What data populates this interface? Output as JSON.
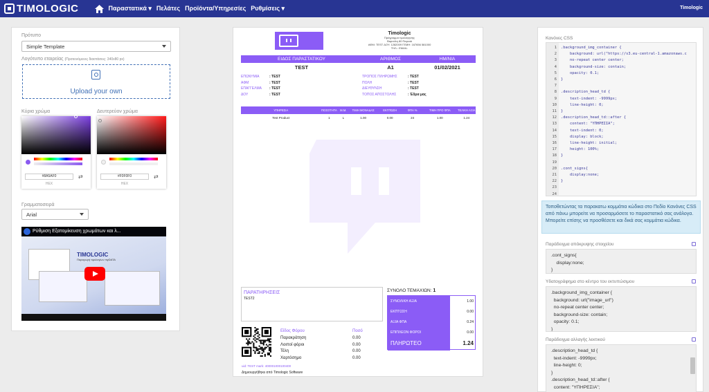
{
  "nav": {
    "brand": "TIMOLOGIC",
    "items": [
      "Παραστατικά ▾",
      "Πελάτες",
      "Προϊόντα/Υπηρεσίες",
      "Ρυθμίσεις ▾"
    ],
    "user": "Timologic"
  },
  "left": {
    "template_label": "Πρότυπο",
    "template_value": "Simple Template",
    "logo_label": "Λογότυπο εταιρείας",
    "logo_hint": "(Προτεινόμενες διαστάσεις: 340x80 px)",
    "upload_text": "Upload your own",
    "primary_color_label": "Κύρια χρώμα",
    "secondary_color_label": "Δευτερεύον χρώμα",
    "primary_hex": "#8A5AF0",
    "secondary_hex": "#F0F0F0",
    "hex_label": "HEX",
    "font_label": "Γραμματοσειρά",
    "font_value": "Arial",
    "video_title": "Ρύθμιση Εξατομίκευση χρωμάτων και λ...",
    "video_brand": "TIMOLOGIC",
    "video_sub": "Παραγωγή τιμολογίων myDATA"
  },
  "colors": {
    "accent": "#8b5cf6",
    "navbar": "#283593",
    "picker_primary_hue": "#7b3fe0",
    "picker_secondary_hue": "#ff1a1a"
  },
  "doc": {
    "company": {
      "name": "Timologic",
      "lines": [
        "Πρόγραμμα τιμολόγησης",
        "Βαρνάλη 80 Πειραιά",
        "ΑΦΜ: TEST ΔΟΥ: 1282009 ΓΕΜΗ: 167656 581000",
        "ΤΗΛ.: EMAIL:"
      ]
    },
    "header_cols": [
      "ΕΙΔΟΣ ΠΑΡΑΣΤΑΤΙΚΟΥ",
      "ΑΡΙΘΜΟΣ",
      "ΗΜ/ΝΙΑ"
    ],
    "header_vals": [
      "TEST",
      "A1",
      "01/02/2021"
    ],
    "info_left": [
      {
        "k": "ΕΠΩΝΥΜΙΑ",
        "v": ": TEST"
      },
      {
        "k": "ΑΦΜ",
        "v": ": TEST"
      },
      {
        "k": "ΕΠΑΓΓΕΛΜΑ",
        "v": ": TEST"
      },
      {
        "k": "ΔΟΥ",
        "v": ": TEST"
      }
    ],
    "info_right": [
      {
        "k": "ΤΡΟΠΟΣ ΠΛΗΡΩΜΗΣ",
        "v": ": TEST"
      },
      {
        "k": "ΠΟΛΗ",
        "v": ": TEST"
      },
      {
        "k": "ΔΙΕΥΘΥΝΣΗ",
        "v": ": TEST"
      },
      {
        "k": "ΤΟΠΟΣ ΑΠΟΣΤΟΛΗΣ",
        "v": ": Έδρα μας"
      }
    ],
    "items_cols": [
      "ΥΠΗΡΕΣΙΑ",
      "ΠΟΣΟΤΗΤΑ",
      "Μ.Μ.",
      "ΤΙΜΗ ΜΟΝΑΔΑΣ",
      "ΕΚΠΤΩΣΗ",
      "ΦΠΑ %",
      "ΤΙΜΗ ΠΡΟ ΦΠΑ",
      "ΤΕΛΙΚΗ ΑΞΙΑ"
    ],
    "items_row": [
      "Test Product",
      "1",
      "L",
      "1.00",
      "0.00",
      "24",
      "1.00",
      "1.24"
    ],
    "notes_title": "ΠΑΡΑΤΗΡΗΣΕΙΣ",
    "notes_text": "TEST2",
    "tax_head": [
      "Είδος Φόρου",
      "Ποσό"
    ],
    "taxes": [
      {
        "k": "Παρακράτηση",
        "v": "0.00"
      },
      {
        "k": "Λοιποί φόροι",
        "v": "0.00"
      },
      {
        "k": "Τέλη",
        "v": "0.00"
      },
      {
        "k": "Χαρτόσημο",
        "v": "0.00"
      }
    ],
    "ids_line": "uid: TEST    mark: 400001000100400",
    "made_with": "Δημιουργήθηκε από Timologic Software",
    "total_items_label": "ΣΥΝΟΛΟ ΤΕΜΑΧΙΩΝ:",
    "total_items_value": "1",
    "totals": [
      {
        "k": "ΣΥΝΟΛΙΚΗ ΑΞΙΑ",
        "v": "1.00"
      },
      {
        "k": "ΕΚΠΤΩΣΗ",
        "v": "0.00"
      },
      {
        "k": "ΑΞΙΑ ΦΠΑ",
        "v": "0.24"
      },
      {
        "k": "ΕΠΙΠΛΕΟΝ ΦΟΡΟΙ",
        "v": "0.00"
      }
    ],
    "grand_label": "ΠΛΗΡΩΤΕΟ",
    "grand_value": "1.24"
  },
  "right": {
    "css_label": "Κανόνες CSS",
    "code_lines": [
      ".background_img_container {",
      "    background: url(\"https://s3.eu-central-1.amazonaws.c",
      "    no-repeat center center;",
      "    background-size: contain;",
      "    opacity: 0.1;",
      "}",
      "",
      ".description_head_td {",
      "    text-indent: -9999px;",
      "    line-height: 0;",
      "}",
      ".description_head_td::after {",
      "    content: \"ΥΠΗΡΕΣΙΑ\";",
      "    text-indent: 0;",
      "    display: block;",
      "    line-height: initial;",
      "    height: 100%;",
      "}",
      "",
      ".cont_signs{",
      "    display:none;",
      "}",
      "",
      ""
    ],
    "info_text": "Τοποθετώντας τα παρακατω κομμάτια κώδικα στο Πεδίο Κανόνες CSS από πάνω μπορείτε να προσαρμόσετε το παραστατικό σας ανάλογα. Μπορείτε επίσης να προσθέσετε και δικά σας κομμάτια κώδικα.",
    "snippets": [
      {
        "label": "Παράδειγμα απόκρυψης στοιχείου",
        "lines": [
          ".cont_signs{",
          "    display:none;",
          "}"
        ]
      },
      {
        "label": "Υδατογράφημα στο κέντρο του εκτυπώσιμου",
        "lines": [
          ".background_img_container {",
          "  background: url(\"image_url\")",
          "  no-repeat center center;",
          "  background-size: contain;",
          "  opacity: 0.1;",
          "}"
        ]
      },
      {
        "label": "Παράδειγμα αλλαγής λεκτικού",
        "lines": [
          ".description_head_td {",
          "  text-indent: -9999px;",
          "  line-height: 0;",
          "}",
          ".description_head_td::after {",
          "  content: \"ΥΠΗΡΕΣΙΑ\";"
        ]
      }
    ]
  }
}
